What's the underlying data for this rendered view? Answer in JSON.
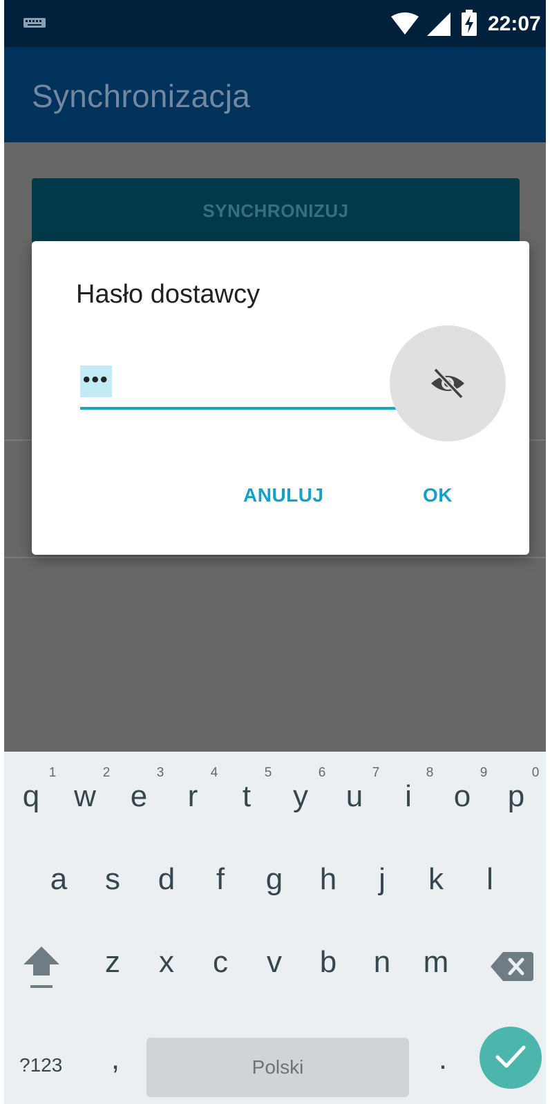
{
  "status_bar": {
    "time": "22:07",
    "icons": [
      "keyboard-icon",
      "wifi-icon",
      "signal-icon",
      "battery-charging-icon"
    ]
  },
  "app_bar": {
    "title": "Synchronizacja"
  },
  "content": {
    "sync_button_label": "SYNCHRONIZUJ"
  },
  "dialog": {
    "title": "Hasło dostawcy",
    "password_value": "•••",
    "toggle_icon": "visibility-off-icon",
    "cancel_label": "ANULUJ",
    "ok_label": "OK"
  },
  "keyboard": {
    "row1": [
      "q",
      "w",
      "e",
      "r",
      "t",
      "y",
      "u",
      "i",
      "o",
      "p"
    ],
    "row1_hints": [
      "1",
      "2",
      "3",
      "4",
      "5",
      "6",
      "7",
      "8",
      "9",
      "0"
    ],
    "row2": [
      "a",
      "s",
      "d",
      "f",
      "g",
      "h",
      "j",
      "k",
      "l"
    ],
    "row3": [
      "z",
      "x",
      "c",
      "v",
      "b",
      "n",
      "m"
    ],
    "symbols_label": "?123",
    "comma": ",",
    "space_label": "Polski",
    "period": ".",
    "shift_icon": "shift-icon",
    "backspace_icon": "backspace-icon",
    "enter_icon": "checkmark-icon"
  },
  "colors": {
    "status_bar": "#01203c",
    "app_bar": "#01325b",
    "accent": "#14a0c8",
    "enter_key": "#4db6ac"
  }
}
